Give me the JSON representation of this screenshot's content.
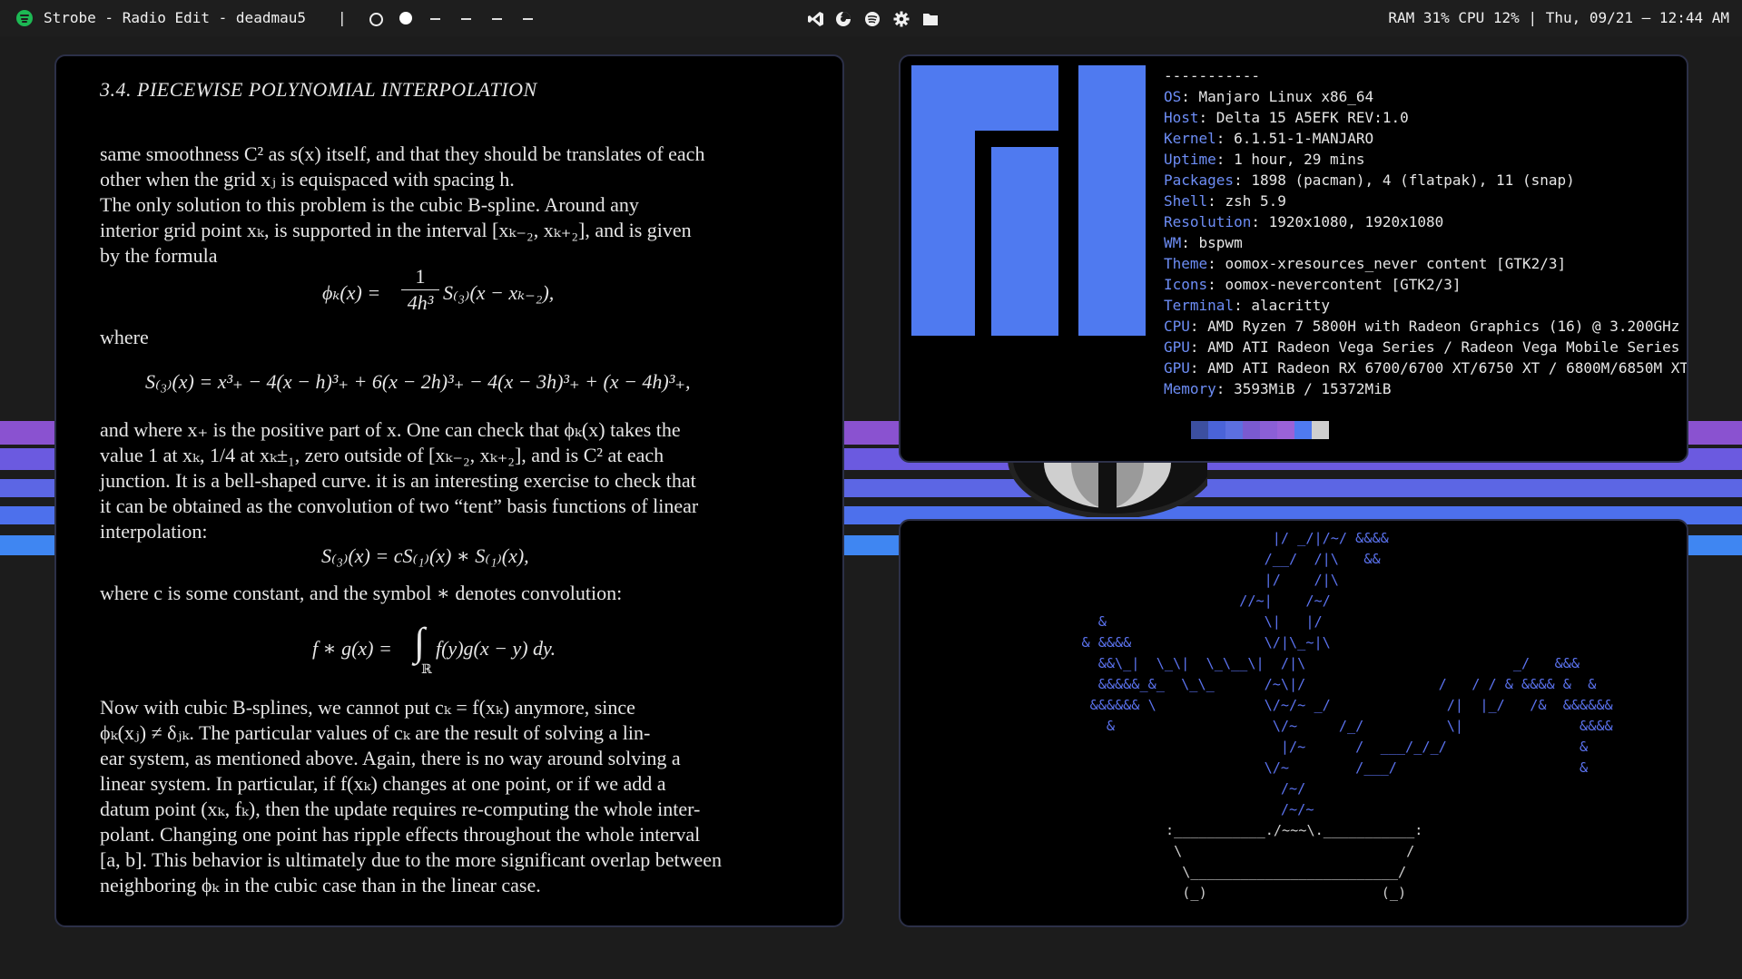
{
  "topbar": {
    "now_playing": "Strobe - Radio Edit - deadmau5",
    "separator": "|",
    "workspaces": [
      "empty",
      "active",
      "dash",
      "dash",
      "dash",
      "dash"
    ],
    "tray_icons": [
      "vscode-icon",
      "browser-icon",
      "spotify-icon",
      "gear-icon",
      "folder-icon"
    ],
    "status": "RAM 31% CPU 12% | Thu, 09/21 — 12:44 AM"
  },
  "pdf": {
    "heading": "3.4.   PIECEWISE POLYNOMIAL INTERPOLATION",
    "lines": [
      "same smoothness C² as s(x) itself, and that they should be translates of each",
      "other when the grid xⱼ is equispaced with spacing h.",
      "     The only solution to this problem is the cubic B-spline.  Around any",
      "interior grid point xₖ, is supported in the interval [xₖ₋₂, xₖ₊₂], and is given",
      "by the formula",
      "where",
      "and where x₊ is the positive part of x. One can check that ϕₖ(x) takes the",
      "value 1 at xₖ, 1/4 at xₖ±₁, zero outside of [xₖ₋₂, xₖ₊₂], and is C² at each",
      "junction. It is a bell-shaped curve. it is an interesting exercise to check that",
      "it can be obtained as the convolution of two “tent” basis functions of linear",
      "interpolation:",
      "where c is some constant, and the symbol ∗ denotes convolution:",
      "     Now with cubic B-splines, we cannot put cₖ = f(xₖ) anymore, since",
      "ϕₖ(xⱼ) ≠ δⱼₖ.  The particular values of cₖ are the result of solving a lin-",
      "ear system, as mentioned above.  Again, there is no way around solving a",
      "linear system.  In particular, if f(xₖ) changes at one point, or if we add a",
      "datum point (xₖ, fₖ), then the update requires re-computing the whole inter-",
      "polant. Changing one point has ripple effects throughout the whole interval",
      "[a, b]. This behavior is ultimately due to the more significant overlap between",
      "neighboring ϕₖ in the cubic case than in the linear case."
    ],
    "eq1_lhs": "ϕₖ(x) =",
    "eq1_num": "1",
    "eq1_den": "4h³",
    "eq1_rhs": "S₍₃₎(x − xₖ₋₂),",
    "eq2": "S₍₃₎(x) = x³₊ − 4(x − h)³₊ + 6(x − 2h)³₊ − 4(x − 3h)³₊ + (x − 4h)³₊,",
    "eq3": "S₍₃₎(x) = cS₍₁₎(x) ∗ S₍₁₎(x),",
    "eq4_lhs": "f ∗ g(x) =",
    "eq4_int": "∫",
    "eq4_sub": "ℝ",
    "eq4_rhs": "f(y)g(x − y) dy."
  },
  "neofetch": {
    "separator": "-----------",
    "info": [
      {
        "key": "OS",
        "value": "Manjaro Linux x86_64"
      },
      {
        "key": "Host",
        "value": "Delta 15 A5EFK REV:1.0"
      },
      {
        "key": "Kernel",
        "value": "6.1.51-1-MANJARO"
      },
      {
        "key": "Uptime",
        "value": "1 hour, 29 mins"
      },
      {
        "key": "Packages",
        "value": "1898 (pacman), 4 (flatpak), 11 (snap)"
      },
      {
        "key": "Shell",
        "value": "zsh 5.9"
      },
      {
        "key": "Resolution",
        "value": "1920x1080, 1920x1080"
      },
      {
        "key": "WM",
        "value": "bspwm"
      },
      {
        "key": "Theme",
        "value": "oomox-xresources_never content [GTK2/3]"
      },
      {
        "key": "Icons",
        "value": "oomox-nevercontent [GTK2/3]"
      },
      {
        "key": "Terminal",
        "value": "alacritty"
      },
      {
        "key": "CPU",
        "value": "AMD Ryzen 7 5800H with Radeon Graphics (16) @ 3.200GHz"
      },
      {
        "key": "GPU",
        "value": "AMD ATI Radeon Vega Series / Radeon Vega Mobile Series"
      },
      {
        "key": "GPU",
        "value": "AMD ATI Radeon RX 6700/6700 XT/6750 XT / 6800M/6850M XT"
      },
      {
        "key": "Memory",
        "value": "3593MiB / 15372MiB"
      }
    ],
    "palette": [
      "#3c4fa0",
      "#4a63d8",
      "#5c6fe0",
      "#7a5ad0",
      "#8b5fd6",
      "#9a62d8",
      "#4f7af0",
      "#cfcfcf"
    ],
    "logo_color": "#4f7af0"
  },
  "bonsai": {
    "tree": [
      "                                        |/ _/|/~/ &&&&",
      "                                       /__/  /|\\   &&",
      "                                       |/    /|\\",
      "                                    //~|    /~/",
      "                   &                   \\|   |/",
      "                 & &&&&                \\/|\\_~|\\",
      "                   &&\\_|  \\_\\|  \\_\\__\\|  /|\\                         _/   &&&",
      "                   &&&&&_&_  \\_\\_      /~\\|/                /   / / & &&&& &  &",
      "                  &&&&&& \\             \\/~/~ _/              /|  |_/   /&  &&&&&&",
      "                    &                   \\/~     /_/          \\|              &&&&",
      "                                         |/~      /  ___/_/_/                &",
      "                                       \\/~        /___/                      &",
      "                                         /~/",
      "                                         /~/~"
    ],
    "pot": [
      ":___________./~~~\\.___________:",
      " \\                           /",
      "  \\_________________________/",
      "  (_)                     (_)"
    ]
  }
}
